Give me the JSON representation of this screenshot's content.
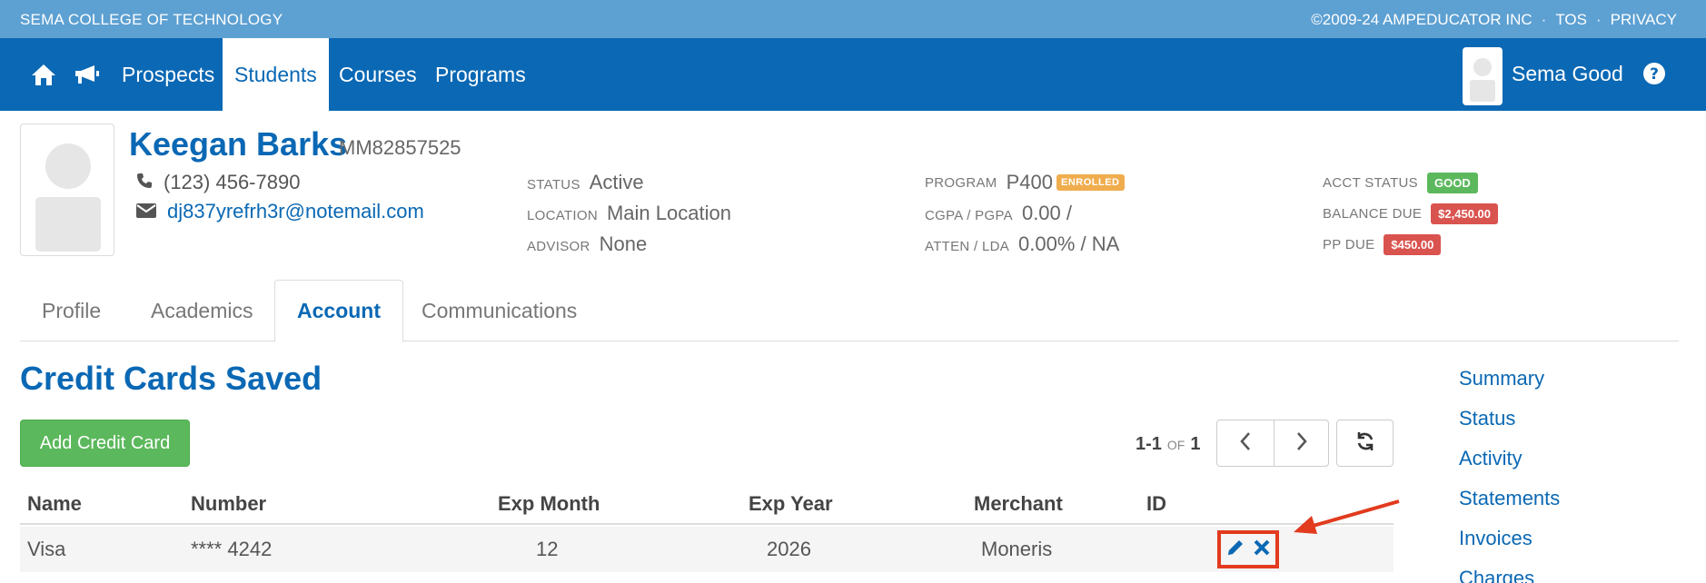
{
  "top": {
    "org": "SEMA COLLEGE OF TECHNOLOGY",
    "copyright": "©2009-24 AMPEDUCATOR INC",
    "tos": "TOS",
    "privacy": "PRIVACY",
    "sep": "·"
  },
  "nav": {
    "items": [
      "Prospects",
      "Students",
      "Courses",
      "Programs"
    ],
    "active": "Students",
    "user_name": "Sema Good"
  },
  "student": {
    "name": "Keegan Barks",
    "id": "MM82857525",
    "phone": "(123) 456-7890",
    "email": "dj837yrefrh3r@notemail.com",
    "status_label": "STATUS",
    "status": "Active",
    "location_label": "LOCATION",
    "location": "Main Location",
    "advisor_label": "ADVISOR",
    "advisor": "None",
    "program_label": "PROGRAM",
    "program": "P400",
    "program_badge": "ENROLLED",
    "gpa_label": "CGPA / PGPA",
    "gpa": "0.00 /",
    "atten_label": "ATTEN / LDA",
    "atten": "0.00% / NA",
    "acct_status_label": "ACCT STATUS",
    "acct_status": "GOOD",
    "balance_label": "BALANCE DUE",
    "balance": "$2,450.00",
    "pp_label": "PP DUE",
    "pp": "$450.00"
  },
  "tabs": [
    "Profile",
    "Academics",
    "Account",
    "Communications"
  ],
  "active_tab": "Account",
  "section": {
    "title": "Credit Cards Saved",
    "add_button": "Add Credit Card",
    "pager_range": "1-1",
    "pager_of": "OF",
    "pager_total": "1"
  },
  "table": {
    "headers": [
      "Name",
      "Number",
      "Exp Month",
      "Exp Year",
      "Merchant",
      "ID"
    ],
    "rows": [
      {
        "name": "Visa",
        "number": "**** 4242",
        "exp_month": "12",
        "exp_year": "2026",
        "merchant": "Moneris",
        "id": ""
      }
    ]
  },
  "side_nav": [
    "Summary",
    "Status",
    "Activity",
    "Statements",
    "Invoices",
    "Charges"
  ],
  "colors": {
    "brand": "#0a68b4",
    "top_strip": "#5da0d2",
    "success": "#5cb85c",
    "danger": "#d9534f",
    "warning": "#f0ad4e",
    "highlight": "#e23b1e"
  },
  "icons": [
    "home-icon",
    "megaphone-icon",
    "help-icon",
    "phone-icon",
    "envelope-icon",
    "chevron-left-icon",
    "chevron-right-icon",
    "refresh-icon",
    "pencil-icon",
    "close-icon",
    "arrow-icon"
  ]
}
